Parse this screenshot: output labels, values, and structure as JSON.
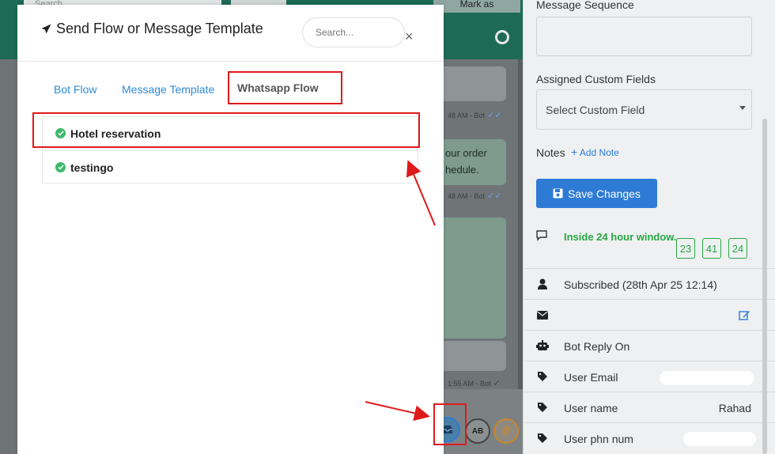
{
  "background": {
    "search_placeholder": "Search",
    "mark_as": "Mark as",
    "messages": [
      {
        "time": "48 AM - Bot",
        "text_line1": "",
        "text_line2": ""
      },
      {
        "time": "",
        "text_line1": "our order",
        "text_line2": "hedule."
      },
      {
        "time": "48 AM - Bot",
        "text_line1": "",
        "text_line2": ""
      },
      {
        "time": "1:55 AM - Bot",
        "text_line1": "",
        "text_line2": ""
      }
    ],
    "composer_icons": [
      "inbox-icon",
      "spellcheck-icon",
      "paperclip-icon"
    ],
    "spellcheck_label": "AB"
  },
  "modal": {
    "title": "Send Flow or Message Template",
    "search_placeholder": "Search...",
    "close": "×",
    "tabs": [
      {
        "label": "Bot Flow",
        "active": false
      },
      {
        "label": "Message Template",
        "active": false
      },
      {
        "label": "Whatsapp Flow",
        "active": true
      }
    ],
    "flows": [
      {
        "name": "Hotel reservation",
        "status": "approved"
      },
      {
        "name": "testingo",
        "status": "approved"
      }
    ]
  },
  "sidebar": {
    "message_sequence_label": "Message Sequence",
    "custom_fields_label": "Assigned Custom Fields",
    "custom_field_select": "Select Custom Field",
    "notes_label": "Notes",
    "add_note": "Add Note",
    "save_button": "Save Changes",
    "window_status": "Inside 24 hour window.",
    "window_counters": [
      "23",
      "41",
      "24"
    ],
    "rows": [
      {
        "icon": "user-icon",
        "text": "Subscribed (28th Apr 25 12:14)",
        "value": ""
      },
      {
        "icon": "envelope-icon",
        "text": "",
        "value": ""
      },
      {
        "icon": "robot-icon",
        "text": "Bot Reply On",
        "value": ""
      },
      {
        "icon": "tag-icon",
        "text": "User Email",
        "value": ""
      },
      {
        "icon": "tag-icon",
        "text": "User name",
        "value": "Rahad"
      },
      {
        "icon": "tag-icon",
        "text": "User phn num",
        "value": ""
      }
    ]
  },
  "colors": {
    "accent": "#2e7bd6",
    "success": "#28a745",
    "highlight": "#e01a1a",
    "header": "#1d6a57"
  }
}
